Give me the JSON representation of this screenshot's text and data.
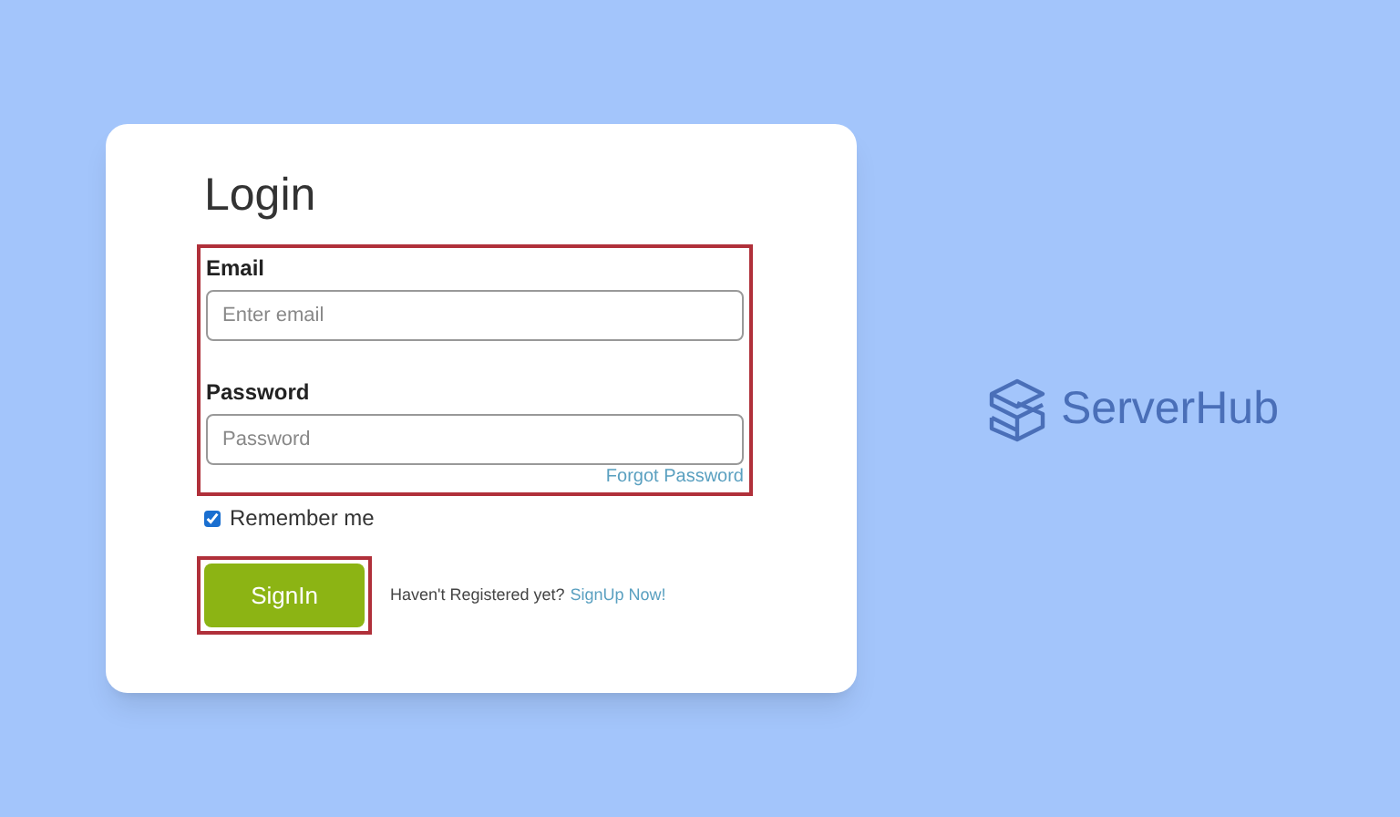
{
  "login_card": {
    "title": "Login",
    "email": {
      "label": "Email",
      "placeholder": "Enter email"
    },
    "password": {
      "label": "Password",
      "placeholder": "Password"
    },
    "forgot_link": "Forgot Password",
    "remember_me": {
      "label": "Remember me",
      "checked": true
    },
    "sign_in_button": "SignIn",
    "register_prompt": "Haven't Registered yet?",
    "register_link": "SignUp Now!"
  },
  "brand": {
    "name": "ServerHub"
  }
}
